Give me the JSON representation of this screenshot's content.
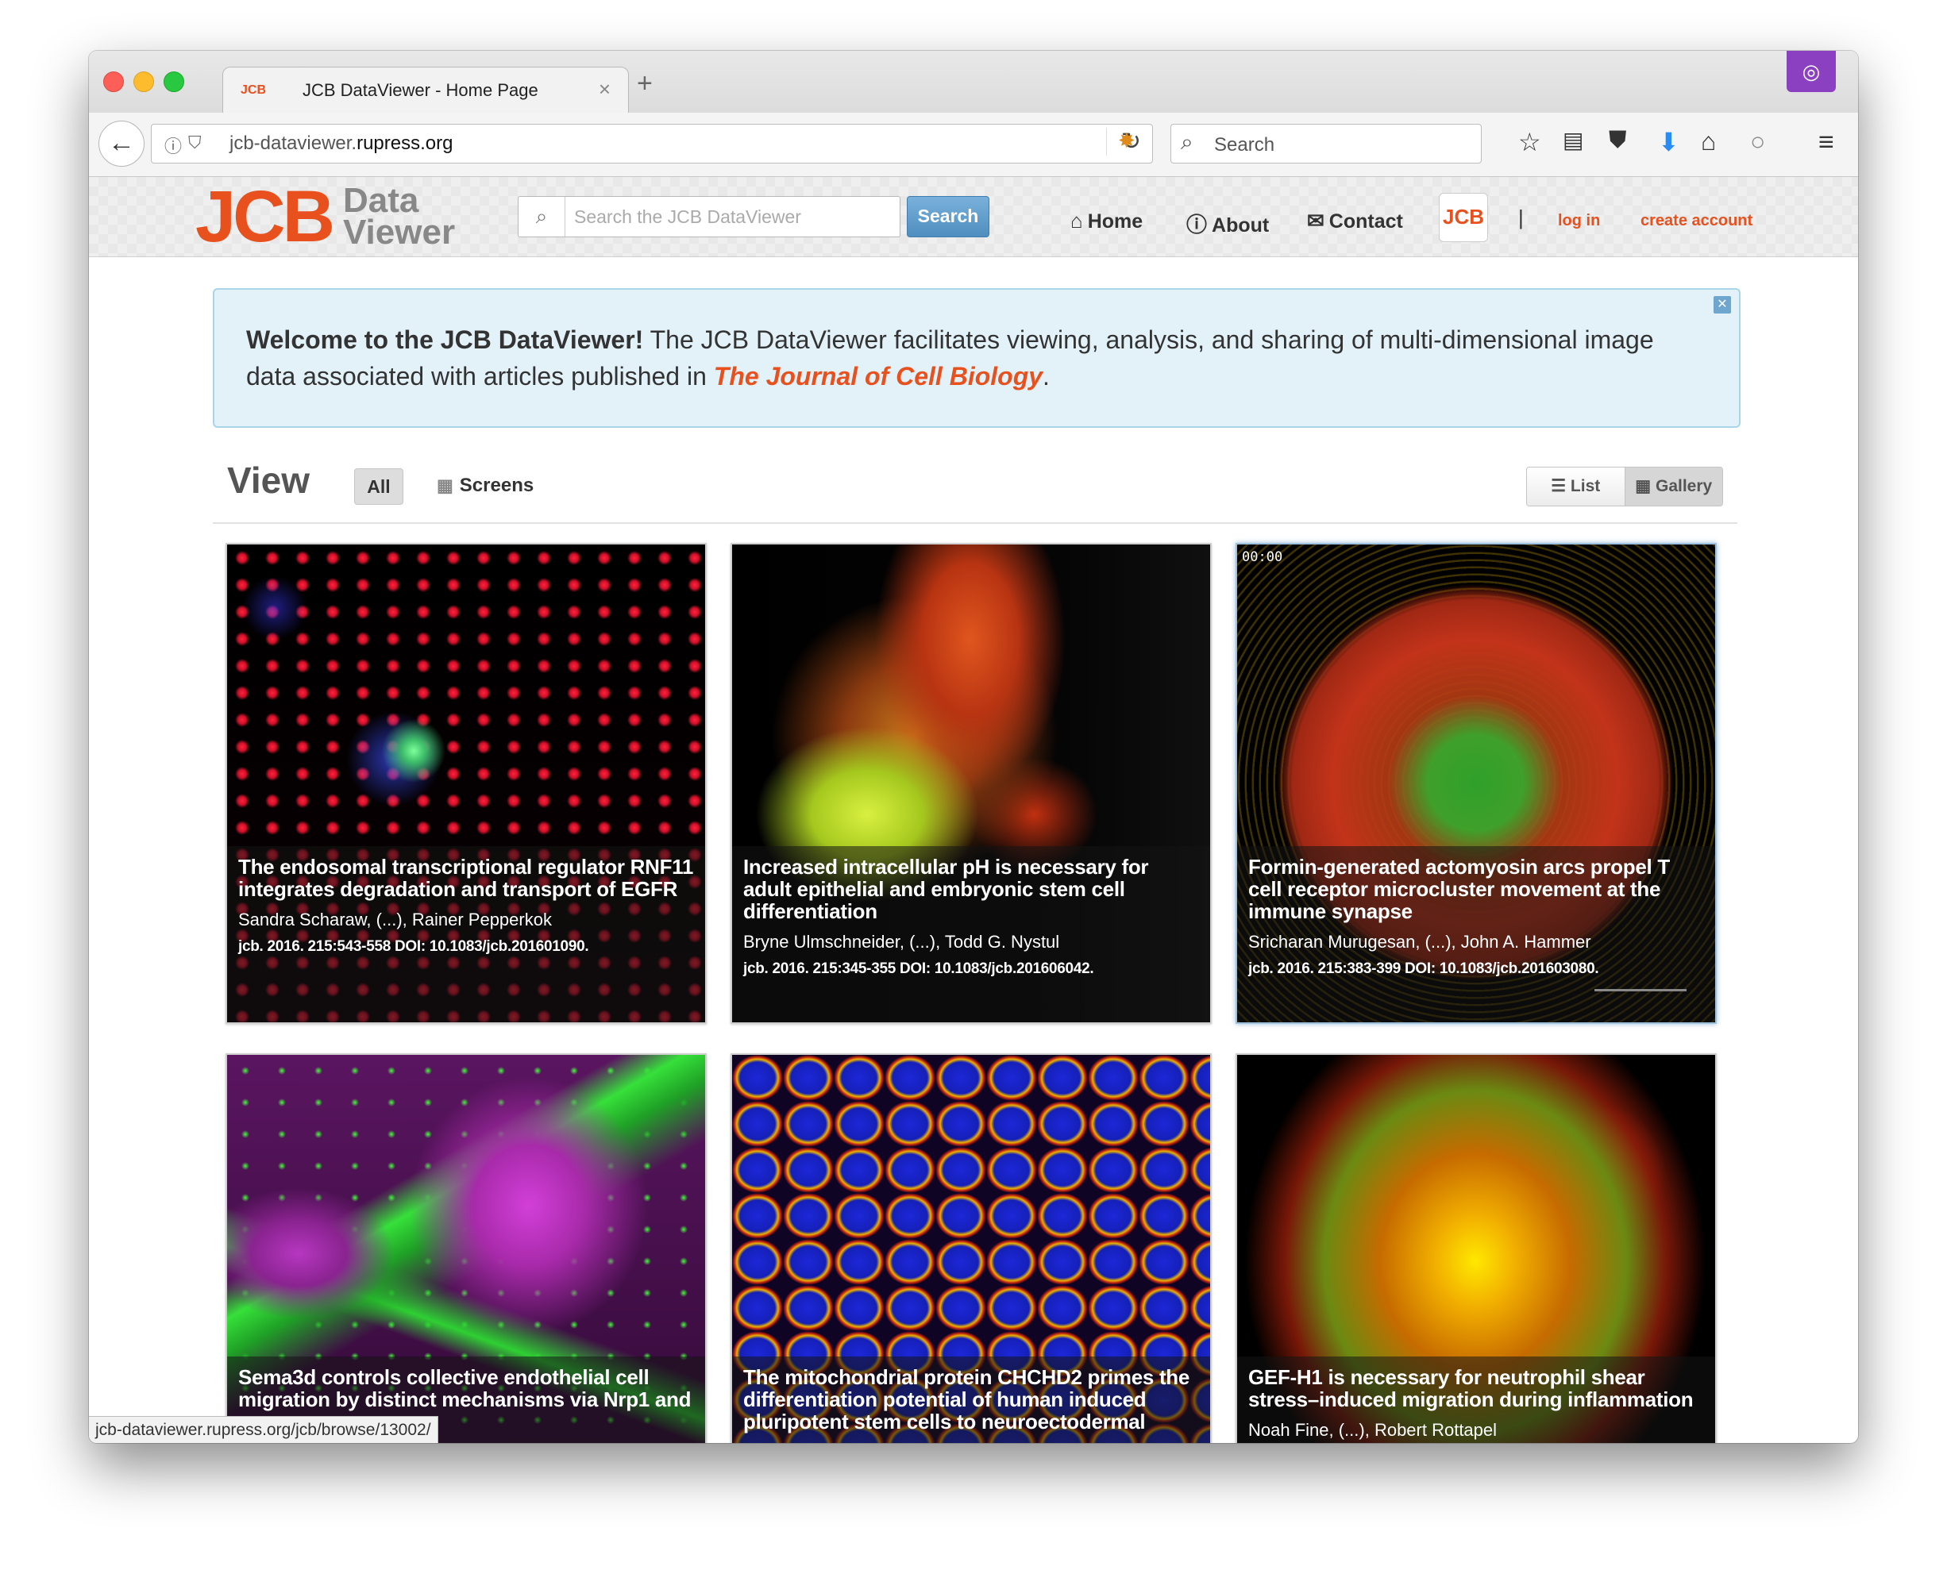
{
  "browser": {
    "tab_favicon": "JCB",
    "tab_title": "JCB DataViewer - Home Page",
    "url_host": "jcb-dataviewer.",
    "url_domain": "rupress.org",
    "search_placeholder": "Search",
    "status_url": "jcb-dataviewer.rupress.org/jcb/browse/13002/",
    "icons": [
      "back-arrow-icon",
      "info-icon",
      "shield-icon",
      "reload-icon",
      "search-icon",
      "bookmark-star-icon",
      "reading-list-icon",
      "pocket-icon",
      "download-icon",
      "home-icon",
      "chat-icon",
      "menu-icon",
      "mask-icon"
    ]
  },
  "site": {
    "logo_main": "JCB",
    "logo_sub": "Data Viewer",
    "search_placeholder": "Search the JCB DataViewer",
    "search_button": "Search",
    "nav": {
      "home": "Home",
      "about": "About",
      "contact": "Contact",
      "jcb": "JCB"
    },
    "separator": "|",
    "login": "log in",
    "create_account": "create account"
  },
  "welcome": {
    "bold": "Welcome to the JCB DataViewer!",
    "text": " The JCB DataViewer facilitates viewing, analysis, and sharing of multi-dimensional image data associated with articles published in ",
    "journal": "The Journal of Cell Biology",
    "end": "."
  },
  "view": {
    "title": "View",
    "filter_all": "All",
    "filter_screens": "Screens",
    "list": "List",
    "gallery": "Gallery"
  },
  "cards": [
    {
      "title": "The endosomal transcriptional regulator RNF11 integrates degradation and transport of EGFR",
      "authors": "Sandra Scharaw, (...), Rainer Pepperkok",
      "ref": "jcb. 2016. 215:543-558 DOI: 10.1083/jcb.201601090."
    },
    {
      "title": "Increased intracellular pH is necessary for adult epithelial and embryonic stem cell differentiation",
      "authors": "Bryne Ulmschneider, (...), Todd G. Nystul",
      "ref": "jcb. 2016. 215:345-355 DOI: 10.1083/jcb.201606042."
    },
    {
      "title": "Formin-generated actomyosin arcs propel T cell receptor microcluster movement at the immune synapse",
      "authors": "Sricharan Murugesan, (...), John A. Hammer",
      "ref": "jcb. 2016. 215:383-399 DOI: 10.1083/jcb.201603080.",
      "timestamp": "00:00"
    },
    {
      "title": "Sema3d controls collective endothelial cell migration by distinct mechanisms via Nrp1 and",
      "authors": "",
      "ref": ""
    },
    {
      "title": "The mitochondrial protein CHCHD2 primes the differentiation potential of human induced pluripotent stem cells to neuroectodermal",
      "authors": "",
      "ref": ""
    },
    {
      "title": "GEF-H1 is necessary for neutrophil shear stress–induced migration during inflammation",
      "authors": "Noah Fine, (...), Robert Rottapel",
      "ref": ""
    }
  ],
  "colors": {
    "accent": "#e8501e",
    "alert_bg": "#e3f2f9",
    "alert_border": "#a8d5ea",
    "button_blue": "#4f8ebf"
  }
}
